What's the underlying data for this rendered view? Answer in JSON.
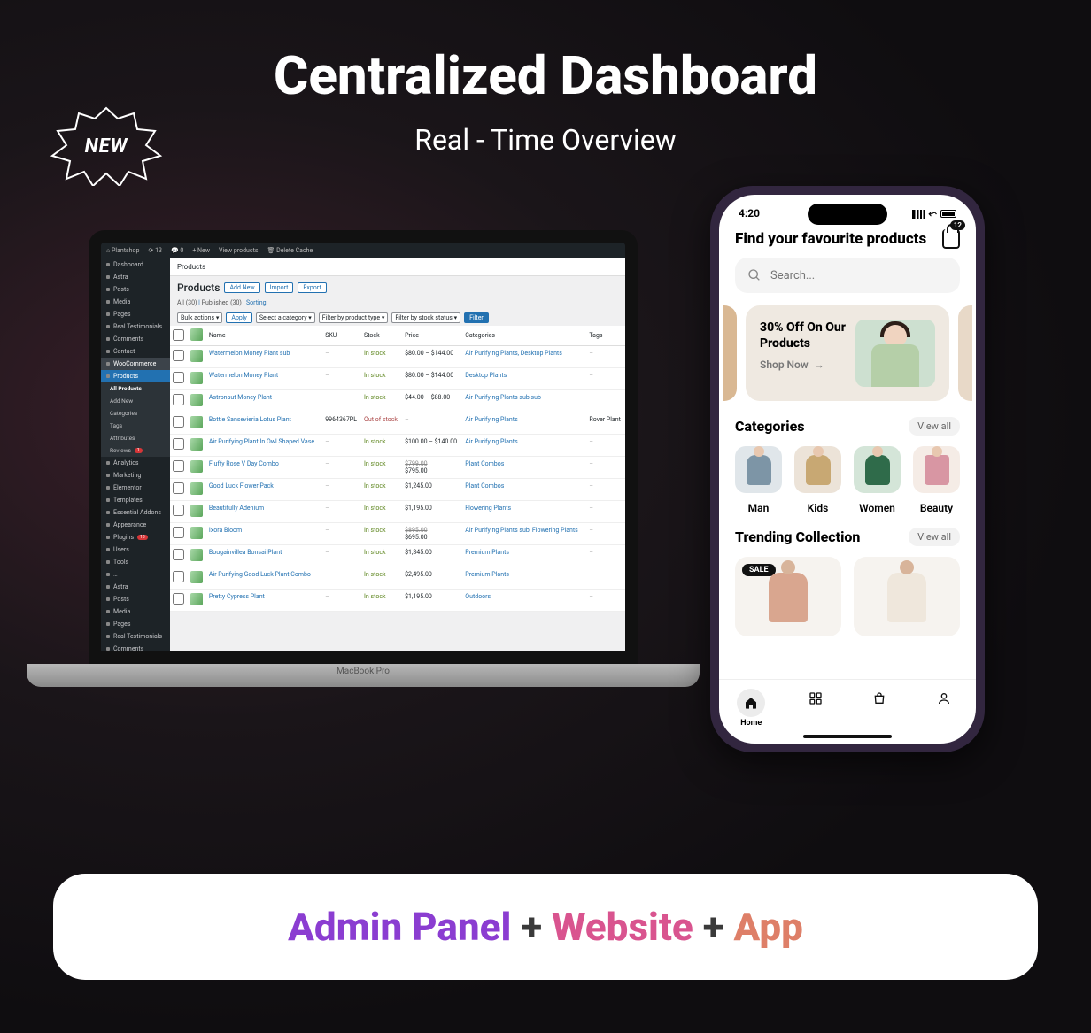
{
  "hero": {
    "title": "Centralized Dashboard",
    "subtitle": "Real - Time Overview",
    "new_badge": "NEW"
  },
  "wp": {
    "topbar": {
      "site": "Plantshop",
      "updates": "13",
      "comments": "0",
      "new": "New",
      "view": "View products",
      "cache": "Delete Cache"
    },
    "menu": {
      "dashboard": "Dashboard",
      "astra": "Astra",
      "posts": "Posts",
      "media": "Media",
      "pages": "Pages",
      "real_testimonials": "Real Testimonials",
      "comments": "Comments",
      "contact": "Contact",
      "woocommerce": "WooCommerce",
      "products": "Products",
      "all_products": "All Products",
      "add_new": "Add New",
      "categories": "Categories",
      "tags": "Tags",
      "attributes": "Attributes",
      "reviews": "Reviews",
      "reviews_badge": "1",
      "analytics": "Analytics",
      "marketing": "Marketing",
      "elementor": "Elementor",
      "templates": "Templates",
      "essential_addons": "Essential Addons",
      "appearance": "Appearance",
      "plugins": "Plugins",
      "plugins_badge": "13",
      "users": "Users",
      "tools": "Tools",
      "astra2": "Astra",
      "posts2": "Posts",
      "media2": "Media",
      "pages2": "Pages",
      "real_testimonials2": "Real Testimonials",
      "comments2": "Comments"
    },
    "crumb": "Products",
    "page": {
      "heading": "Products",
      "add": "Add New",
      "import": "Import",
      "export": "Export",
      "subsub_all": "All",
      "subsub_all_n": "(30)",
      "subsub_pub": "Published",
      "subsub_pub_n": "(30)",
      "subsub_sort": "Sorting",
      "bulk": "Bulk actions",
      "apply": "Apply",
      "cat": "Select a category",
      "ptype": "Filter by product type",
      "stock": "Filter by stock status",
      "filter": "Filter"
    },
    "cols": {
      "name": "Name",
      "sku": "SKU",
      "stock": "Stock",
      "price": "Price",
      "categories": "Categories",
      "tags": "Tags"
    },
    "rows": [
      {
        "name": "Watermelon Money Plant sub",
        "sku": "–",
        "stock": "In stock",
        "price": "$80.00 – $144.00",
        "cat": "Air Purifying Plants, Desktop Plants",
        "tags": "–"
      },
      {
        "name": "Watermelon Money Plant",
        "sku": "–",
        "stock": "In stock",
        "price": "$80.00 – $144.00",
        "cat": "Desktop Plants",
        "tags": "–"
      },
      {
        "name": "Astronaut Money Plant",
        "sku": "–",
        "stock": "In stock",
        "price": "$44.00 – $88.00",
        "cat": "Air Purifying Plants sub sub",
        "tags": "–"
      },
      {
        "name": "Bottle Sansevieria Lotus Plant",
        "sku": "9964367PL",
        "stock": "Out of stock",
        "price": "–",
        "cat": "Air Purifying Plants",
        "tags": "Rover Plant"
      },
      {
        "name": "Air Purifying Plant In Owl Shaped Vase",
        "sku": "–",
        "stock": "In stock",
        "price": "$100.00 – $140.00",
        "cat": "Air Purifying Plants",
        "tags": "–"
      },
      {
        "name": "Fluffy Rose V Day Combo",
        "sku": "–",
        "stock": "In stock",
        "price": "$795.00",
        "old": "$799.00",
        "cat": "Plant Combos",
        "tags": "–"
      },
      {
        "name": "Good Luck Flower Pack",
        "sku": "–",
        "stock": "In stock",
        "price": "$1,245.00",
        "cat": "Plant Combos",
        "tags": "–"
      },
      {
        "name": "Beautifully Adenium",
        "sku": "–",
        "stock": "In stock",
        "price": "$1,195.00",
        "cat": "Flowering Plants",
        "tags": "–"
      },
      {
        "name": "Ixora Bloom",
        "sku": "–",
        "stock": "In stock",
        "price": "$695.00",
        "old": "$895.00",
        "cat": "Air Purifying Plants sub, Flowering Plants",
        "tags": "–"
      },
      {
        "name": "Bougainvillea Bonsai Plant",
        "sku": "–",
        "stock": "In stock",
        "price": "$1,345.00",
        "cat": "Premium Plants",
        "tags": "–"
      },
      {
        "name": "Air Purifying Good Luck Plant Combo",
        "sku": "–",
        "stock": "In stock",
        "price": "$2,495.00",
        "cat": "Premium Plants",
        "tags": "–"
      },
      {
        "name": "Pretty Cypress Plant",
        "sku": "–",
        "stock": "In stock",
        "price": "$1,195.00",
        "cat": "Outdoors",
        "tags": "–"
      }
    ]
  },
  "app": {
    "time": "4:20",
    "bag_count": "12",
    "heading": "Find your favourite products",
    "search_placeholder": "Search...",
    "banner": {
      "title_l1": "30% Off On Our",
      "title_l2": "Products",
      "cta": "Shop Now"
    },
    "cat_title": "Categories",
    "view_all": "View all",
    "cats": [
      "Man",
      "Kids",
      "Women",
      "Beauty"
    ],
    "trend_title": "Trending Collection",
    "sale": "SALE",
    "tabs": {
      "home": "Home"
    }
  },
  "pill": {
    "a": "Admin Panel",
    "p1": "+",
    "b": "Website",
    "p2": "+",
    "c": "App"
  },
  "laptop_label": "MacBook Pro"
}
